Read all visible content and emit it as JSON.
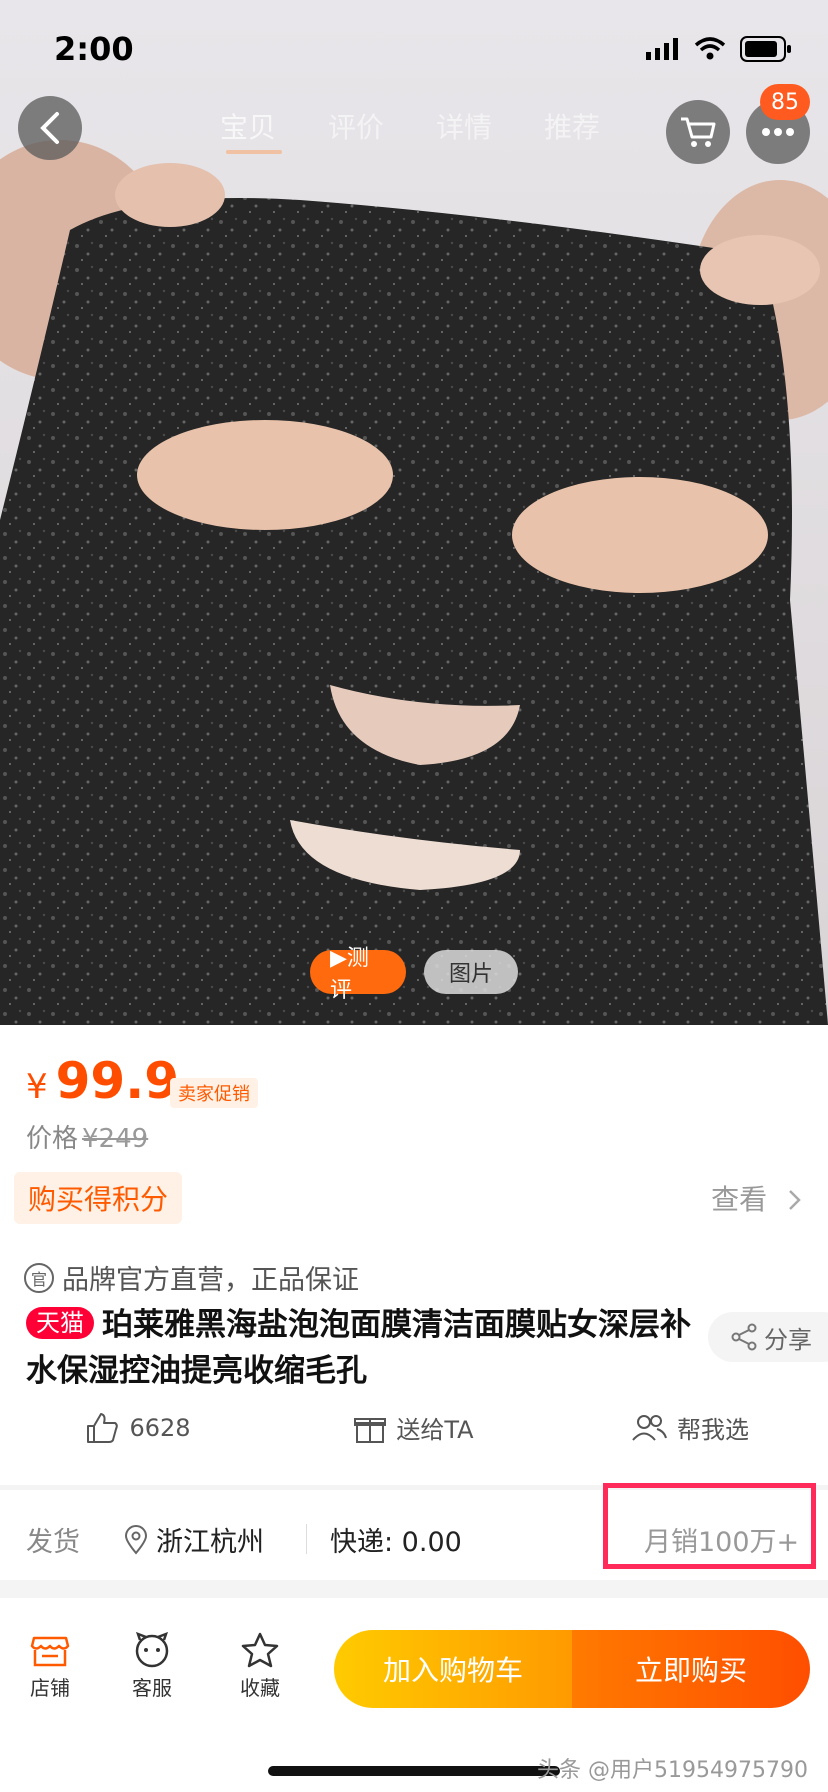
{
  "status_bar": {
    "time": "2:00"
  },
  "nav": {
    "tabs": [
      {
        "label": "宝贝",
        "active": true
      },
      {
        "label": "评价",
        "active": false
      },
      {
        "label": "详情",
        "active": false
      },
      {
        "label": "推荐",
        "active": false
      }
    ],
    "badge": "85"
  },
  "media": {
    "review_label": "▶测评",
    "photo_label": "图片"
  },
  "price": {
    "currency": "¥",
    "value": "99.9",
    "promo": "卖家促销",
    "original_label": "价格",
    "original_value": "¥249"
  },
  "points": {
    "label": "购买得积分",
    "view": "查看"
  },
  "product": {
    "official": "品牌官方直营，正品保证",
    "official_icon": "官",
    "tmall": "天猫",
    "title": "珀莱雅黑海盐泡泡面膜清洁面膜贴女深层补水保湿控油提亮收缩毛孔",
    "share": "分享"
  },
  "actions": {
    "likes": "6628",
    "gift": "送给TA",
    "help": "帮我选"
  },
  "shipping": {
    "label": "发货",
    "location": "浙江杭州",
    "fee": "快递: 0.00",
    "monthly_sales": "月销100万+"
  },
  "bottom_bar": {
    "store": "店铺",
    "service": "客服",
    "favorite": "收藏",
    "add_cart": "加入购物车",
    "buy_now": "立即购买"
  },
  "watermark": "头条 @用户51954975790",
  "colors": {
    "accent": "#ff4d00",
    "tmall": "#ff0036",
    "highlight": "#ff2a5a"
  }
}
